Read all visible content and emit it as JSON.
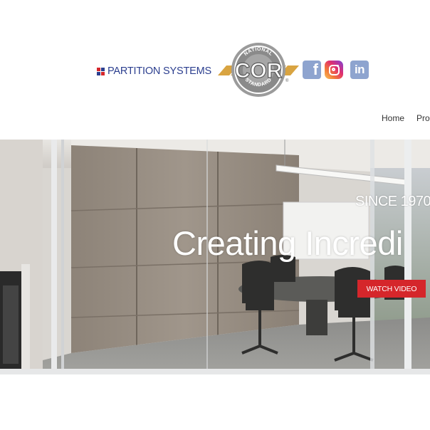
{
  "header": {
    "brand_name": "PARTITION SYSTEMS",
    "brand_colors": [
      "#d5262b",
      "#2c3f8f",
      "#2c3f8f",
      "#d5262b"
    ],
    "cor_badge": {
      "top_text": "NATIONAL",
      "main_text": "COR",
      "bottom_text": "STANDARD",
      "mark": "®"
    },
    "social": [
      {
        "name": "facebook-icon",
        "glyph": "f"
      },
      {
        "name": "instagram-icon",
        "glyph": ""
      },
      {
        "name": "linkedin-icon",
        "glyph": "in"
      }
    ]
  },
  "nav": {
    "items": [
      "Home",
      "Prod"
    ]
  },
  "hero": {
    "since": "SINCE 1970",
    "headline": "Creating Incredi",
    "cta_label": "WATCH VIDEO"
  },
  "colors": {
    "brand_blue": "#2c3f8f",
    "cta_red": "#d5262b",
    "badge_gold": "#d9a441",
    "badge_gray": "#8a8a8a",
    "social_blue": "#8ea4cf"
  }
}
